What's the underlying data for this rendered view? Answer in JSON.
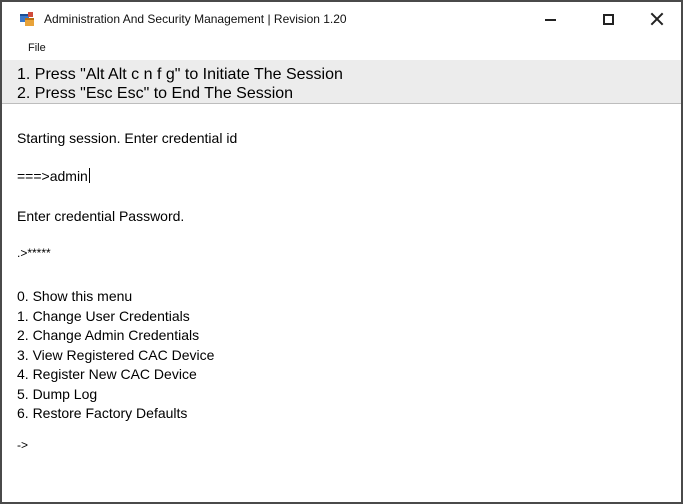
{
  "window": {
    "title": "Administration And Security Management  |  Revision 1.20"
  },
  "menubar": {
    "file_label": "File"
  },
  "instructions": {
    "line1": "1. Press \"Alt Alt c n f g\" to Initiate The Session",
    "line2": "2. Press \"Esc Esc\" to End The Session"
  },
  "console": {
    "prompt_id": "Starting session. Enter credential id",
    "id_entry": "===>admin",
    "prompt_password": "Enter credential Password.",
    "password_entry": ".>*****",
    "menu_items": [
      "0.  Show this menu",
      "1.  Change User Credentials",
      "2.  Change Admin Credentials",
      "3.  View Registered CAC Device",
      "4.  Register New CAC Device",
      "5.  Dump Log",
      "6.  Restore Factory Defaults"
    ],
    "final_prompt": "->"
  },
  "icons": {
    "app": "app-window-icon",
    "minimize": "minimize-icon",
    "maximize": "maximize-icon",
    "close": "close-icon"
  }
}
